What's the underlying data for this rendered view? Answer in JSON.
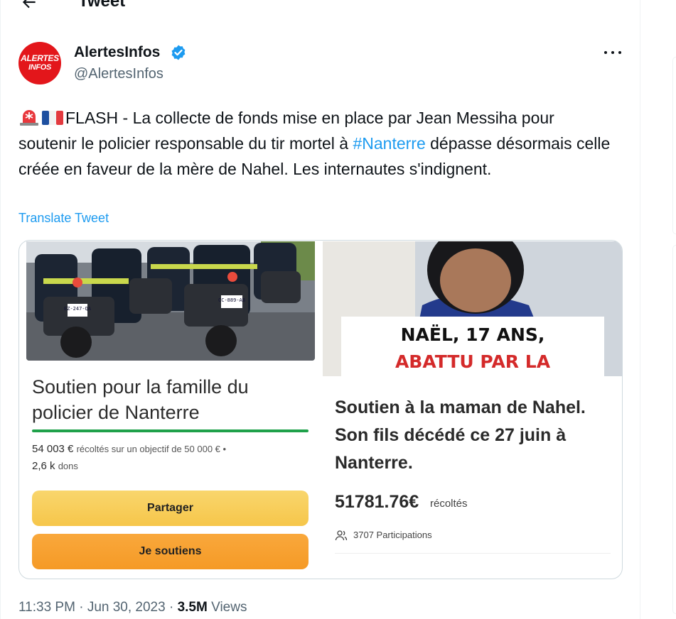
{
  "header": {
    "title": "Tweet"
  },
  "author": {
    "name": "AlertesInfos",
    "handle": "@AlertesInfos",
    "avatar_line1": "ALERTES",
    "avatar_line2": "INFOS"
  },
  "tweet": {
    "text_before": "FLASH - La collecte de fonds mise en place par Jean Messiha pour soutenir le policier responsable du tir mortel à ",
    "hashtag": "#Nanterre",
    "text_after": " dépasse désormais celle créée en faveur de la mère de Nahel. Les internautes s'indignent.",
    "translate": "Translate Tweet"
  },
  "media": {
    "left": {
      "plate1": "EZ-247-QA",
      "plate2": "CC-889-AB",
      "title": "Soutien pour la famille du policier de Nanterre",
      "amount": "54 003 €",
      "amount_note": "récoltés sur un objectif de 50 000 € •",
      "donations": "2,6 k",
      "donations_label": "dons",
      "progress": 1.0,
      "share_button": "Partager",
      "support_button": "Je soutiens"
    },
    "right": {
      "overlay_line1": "NAËL, 17 ANS,",
      "overlay_line2": "ABATTU PAR LA",
      "title": "Soutien à la maman de Nahel. Son fils décédé ce 27 juin à Nanterre.",
      "amount": "51781.76€",
      "amount_label": "récoltés",
      "participants": "3707 Participations"
    }
  },
  "meta": {
    "time": "11:33 PM",
    "sep1": "·",
    "date": "Jun 30, 2023",
    "sep2": "·",
    "views_count": "3.5M",
    "views_label": "Views"
  },
  "colors": {
    "link": "#1d9bf0",
    "avatar_bg": "#e3161b",
    "verified": "#1d9bf0",
    "progress": "#1fa14a"
  }
}
